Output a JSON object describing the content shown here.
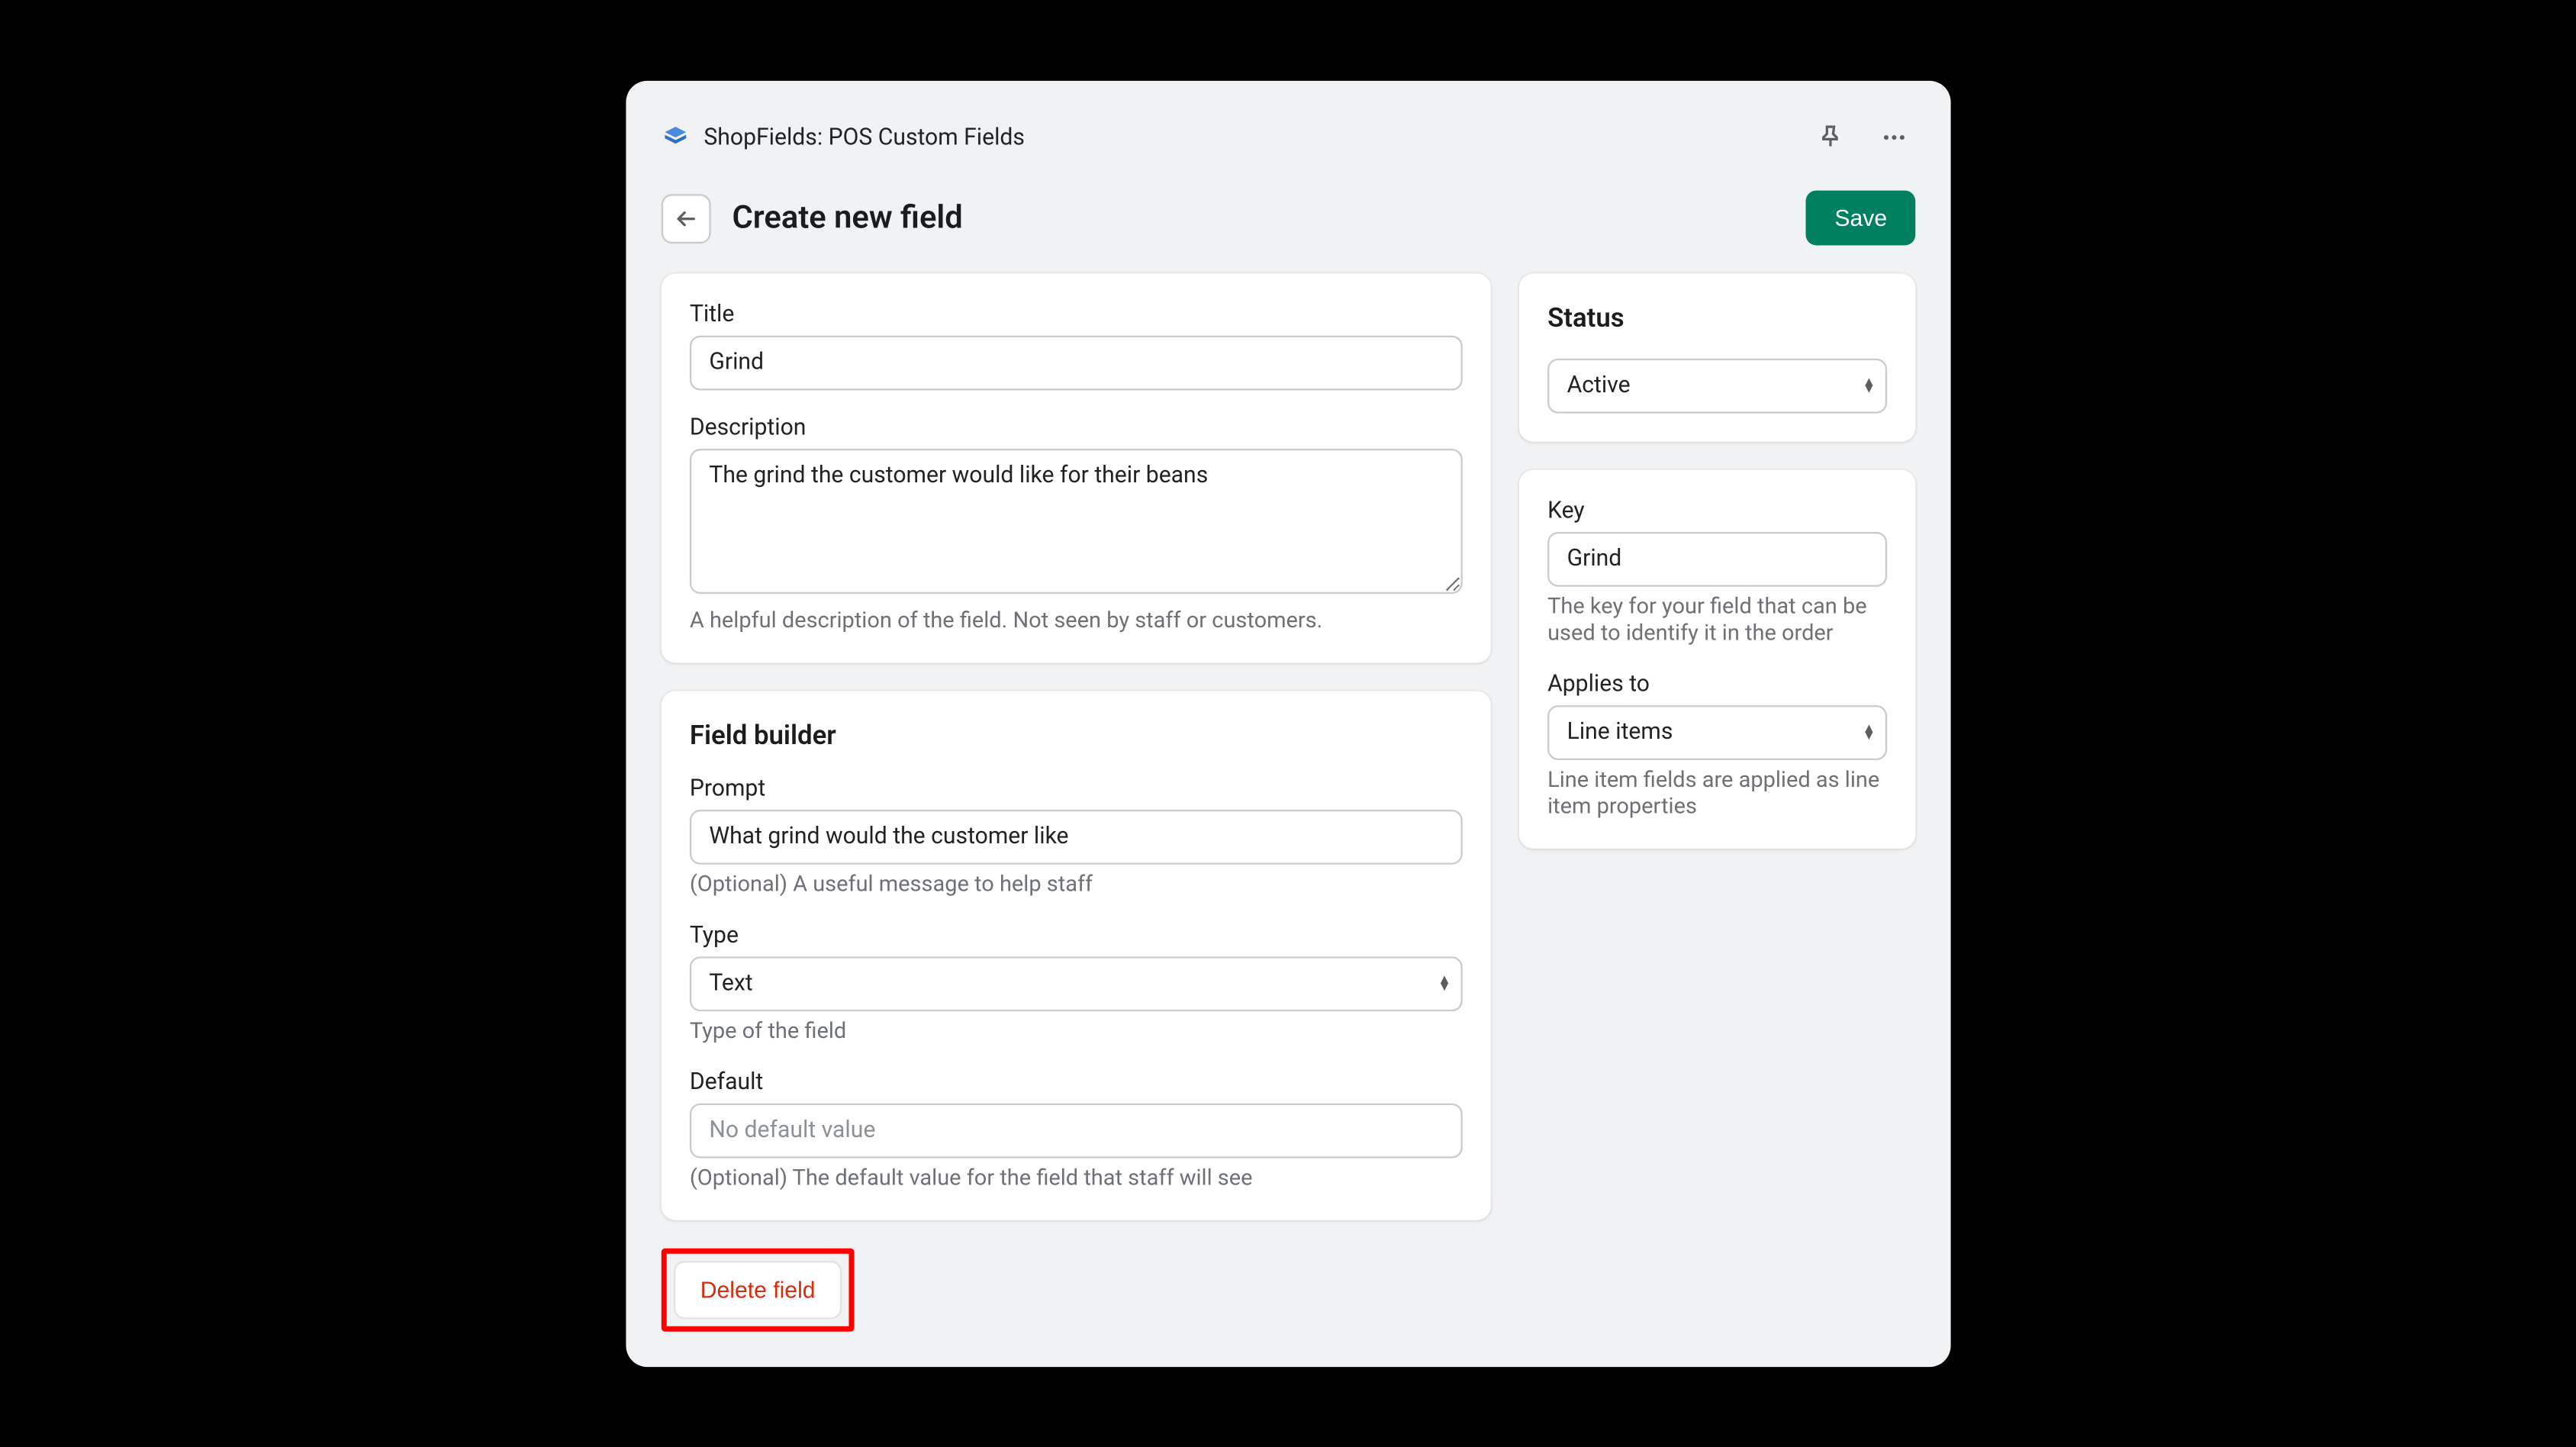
{
  "app_name": "ShopFields: POS Custom Fields",
  "page_title": "Create new field",
  "save_label": "Save",
  "main": {
    "title": {
      "label": "Title",
      "value": "Grind"
    },
    "description": {
      "label": "Description",
      "value": "The grind the customer would like for their beans",
      "help": "A helpful description of the field. Not seen by staff or customers."
    }
  },
  "builder": {
    "heading": "Field builder",
    "prompt": {
      "label": "Prompt",
      "value": "What grind would the customer like",
      "help": "(Optional) A useful message to help staff"
    },
    "type": {
      "label": "Type",
      "value": "Text",
      "help": "Type of the field"
    },
    "default": {
      "label": "Default",
      "placeholder": "No default value",
      "help": "(Optional) The default value for the field that staff will see"
    }
  },
  "status": {
    "heading": "Status",
    "value": "Active"
  },
  "key": {
    "label": "Key",
    "value": "Grind",
    "help": "The key for your field that can be used to identify it in the order"
  },
  "applies_to": {
    "label": "Applies to",
    "value": "Line items",
    "help": "Line item fields are applied as line item properties"
  },
  "delete_label": "Delete field"
}
